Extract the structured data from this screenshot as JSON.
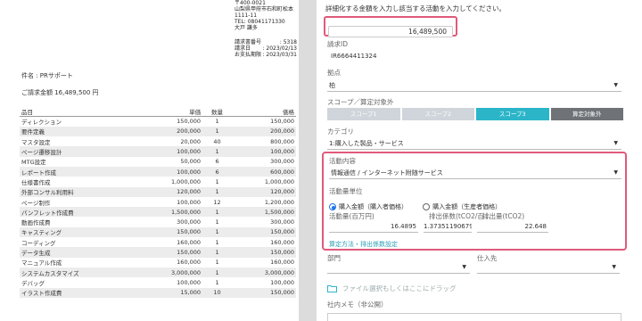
{
  "invoice": {
    "sender_lines": [
      "〒400-0021",
      "山梨県甲府市石和町松本",
      "1111-11",
      "TEL: 08041171330",
      "大戸 謙多"
    ],
    "meta": [
      {
        "label": "請求書番号",
        "value": ": 5318"
      },
      {
        "label": "請求日",
        "value": ": 2023/02/13"
      },
      {
        "label": "お支払期限",
        "value": ": 2023/03/31"
      }
    ],
    "subject": "件名 : PRサポート",
    "total": "ご請求金額 16,489,500 円",
    "headers": {
      "item": "品目",
      "price": "単価",
      "qty": "数量",
      "amount": "価格"
    },
    "rows": [
      [
        "ディレクション",
        "150,000",
        "1",
        "150,000"
      ],
      [
        "要件定義",
        "200,000",
        "1",
        "200,000"
      ],
      [
        "マスタ設定",
        "20,000",
        "40",
        "800,000"
      ],
      [
        "ページ遷移設計",
        "100,000",
        "1",
        "100,000"
      ],
      [
        "MTG設定",
        "50,000",
        "6",
        "300,000"
      ],
      [
        "レポート作成",
        "100,000",
        "6",
        "600,000"
      ],
      [
        "仕様書作成",
        "1,000,000",
        "1",
        "1,000,000"
      ],
      [
        "外部コンサル利用料",
        "120,000",
        "1",
        "120,000"
      ],
      [
        "ページ制作",
        "100,000",
        "12",
        "1,200,000"
      ],
      [
        "パンフレット作成費",
        "1,500,000",
        "1",
        "1,500,000"
      ],
      [
        "動画作成費",
        "300,000",
        "1",
        "300,000"
      ],
      [
        "キャスティング",
        "150,000",
        "1",
        "150,000"
      ],
      [
        "コーディング",
        "160,000",
        "1",
        "160,000"
      ],
      [
        "データ生成",
        "150,000",
        "1",
        "150,000"
      ],
      [
        "マニュアル作成",
        "160,000",
        "1",
        "160,000"
      ],
      [
        "システムカスタマイズ",
        "3,000,000",
        "1",
        "3,000,000"
      ],
      [
        "デバッグ",
        "100,000",
        "1",
        "100,000"
      ],
      [
        "イラスト作成費",
        "15,000",
        "10",
        "150,000"
      ]
    ]
  },
  "form": {
    "instruction": "詳細化する金額を入力し該当する活動を入力してください。",
    "amount_value": "16,489,500",
    "invoice_id_label": "請求ID",
    "invoice_id_value": "IR6664411324",
    "site_label": "拠点",
    "site_value": "柏",
    "scope_label": "スコープ／算定対象外",
    "scope_tabs": [
      "スコープ1",
      "スコープ2",
      "スコープ3",
      "算定対象外"
    ],
    "category_label": "カテゴリ",
    "category_value": "1:購入した製品・サービス",
    "activity_label": "活動内容",
    "activity_value": "情報通信 / インターネット附随サービス",
    "unit_label": "活動量単位",
    "unit_options": [
      "購入金額（購入者価格）",
      "購入金額（生産者価格）"
    ],
    "col_activity_label": "活動量(百万円)",
    "col_factor_label": "排出係数(tCO2/百…",
    "col_emission_label": "排出量(tCO2)",
    "activity_amount": "16.4895",
    "emission_factor": "1.3735119067981",
    "emission_amount": "22.648",
    "calc_link": "算定方法・排出係数設定",
    "dept_label": "部門",
    "supplier_label": "仕入先",
    "file_drop_text": "ファイル選択もしくはここにドラッグ",
    "memo_label": "社内メモ（非公開）"
  }
}
